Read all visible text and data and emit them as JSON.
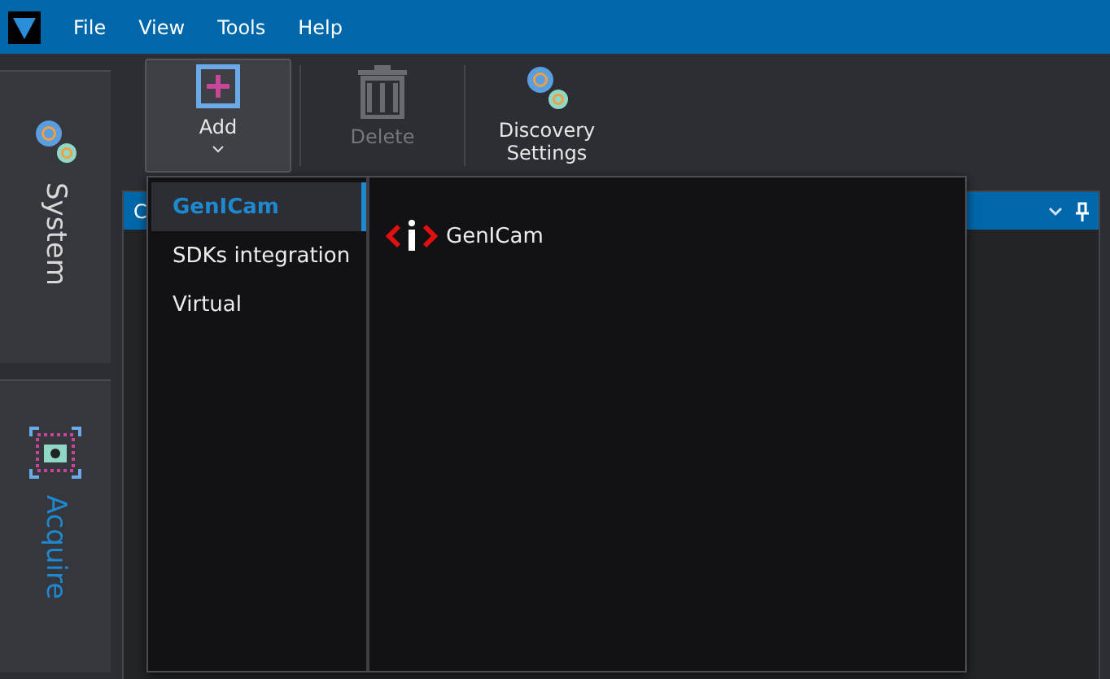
{
  "menu": [
    "File",
    "View",
    "Tools",
    "Help"
  ],
  "side_tabs": [
    {
      "label": "System",
      "selected": false,
      "kind": "gears"
    },
    {
      "label": "Acquire",
      "selected": true,
      "kind": "camera"
    }
  ],
  "toolbar": [
    {
      "label": "Add",
      "kind": "add",
      "disabled": false,
      "pressed": true
    },
    {
      "label": "Delete",
      "kind": "delete",
      "disabled": true,
      "pressed": false
    },
    {
      "label": "Discovery Settings",
      "kind": "gears",
      "disabled": false,
      "pressed": false
    }
  ],
  "panel": {
    "title": "C"
  },
  "popup": {
    "categories": [
      {
        "label": "GenICam",
        "selected": true
      },
      {
        "label": "SDKs integration",
        "selected": false
      },
      {
        "label": "Virtual",
        "selected": false
      }
    ],
    "items": [
      {
        "label": "GenICam"
      }
    ]
  }
}
